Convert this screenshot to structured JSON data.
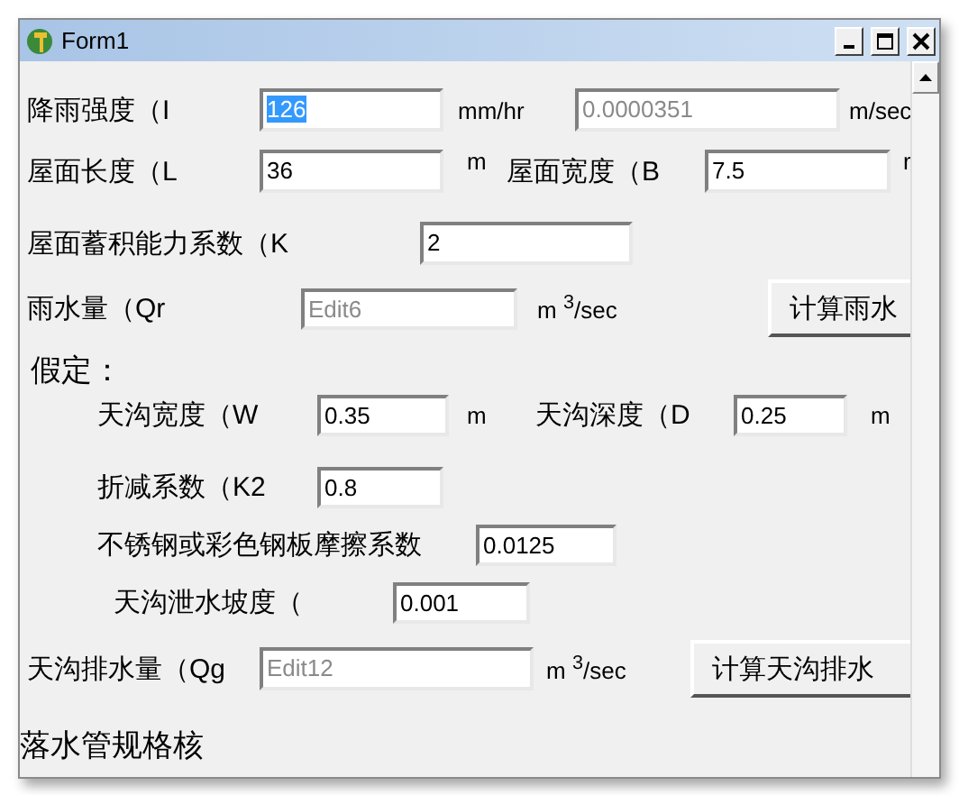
{
  "window": {
    "title": "Form1"
  },
  "rows": [
    {
      "items": [
        {
          "kind": "label",
          "text": "降雨强度（I"
        },
        {
          "kind": "field",
          "value": "126",
          "selected": true,
          "disabled": false
        },
        {
          "kind": "unit",
          "text": "mm/hr"
        },
        {
          "kind": "field",
          "value": "0.0000351",
          "selected": false,
          "disabled": true
        },
        {
          "kind": "unit",
          "text": "m/sec"
        }
      ]
    },
    {
      "items": [
        {
          "kind": "label",
          "text": "屋面长度（L"
        },
        {
          "kind": "field",
          "value": "36",
          "selected": false,
          "disabled": false
        },
        {
          "kind": "unit",
          "text": "m"
        },
        {
          "kind": "label",
          "text": "屋面宽度（B"
        },
        {
          "kind": "field",
          "value": "7.5",
          "selected": false,
          "disabled": false
        },
        {
          "kind": "unit",
          "text": "r"
        }
      ]
    },
    {
      "items": [
        {
          "kind": "label",
          "text": "屋面蓄积能力系数（K"
        },
        {
          "kind": "field",
          "value": "2",
          "selected": false,
          "disabled": false
        }
      ]
    },
    {
      "items": [
        {
          "kind": "label",
          "text": "雨水量（Qr"
        },
        {
          "kind": "field",
          "value": "Edit6",
          "selected": false,
          "disabled": true
        },
        {
          "kind": "unit",
          "text": "m $^{3}$/sec"
        },
        {
          "kind": "button",
          "text": "计算雨水"
        }
      ]
    },
    {
      "items": [
        {
          "kind": "heading",
          "text": "假定："
        }
      ]
    },
    {
      "items": [
        {
          "kind": "label",
          "text": "天沟宽度（W"
        },
        {
          "kind": "field",
          "value": "0.35",
          "selected": false,
          "disabled": false
        },
        {
          "kind": "unit",
          "text": "m"
        },
        {
          "kind": "label",
          "text": "天沟深度（D"
        },
        {
          "kind": "field",
          "value": "0.25",
          "selected": false,
          "disabled": false
        },
        {
          "kind": "unit",
          "text": "m"
        }
      ]
    },
    {
      "items": [
        {
          "kind": "label",
          "text": "折减系数（K2"
        },
        {
          "kind": "field",
          "value": "0.8",
          "selected": false,
          "disabled": false
        }
      ]
    },
    {
      "items": [
        {
          "kind": "label",
          "text": "不锈钢或彩色钢板摩擦系数"
        },
        {
          "kind": "field",
          "value": "0.0125",
          "selected": false,
          "disabled": false
        }
      ]
    },
    {
      "items": [
        {
          "kind": "label",
          "text": "天沟泄水坡度（"
        },
        {
          "kind": "field",
          "value": "0.001",
          "selected": false,
          "disabled": false
        }
      ]
    },
    {
      "items": [
        {
          "kind": "label",
          "text": "天沟排水量（Qg"
        },
        {
          "kind": "field",
          "value": "Edit12",
          "selected": false,
          "disabled": true
        },
        {
          "kind": "unit",
          "text": "m $^{3}$/sec"
        },
        {
          "kind": "button",
          "text": "计算天沟排水"
        }
      ]
    },
    {
      "items": [
        {
          "kind": "heading",
          "text": "落水管规格核"
        }
      ]
    }
  ]
}
